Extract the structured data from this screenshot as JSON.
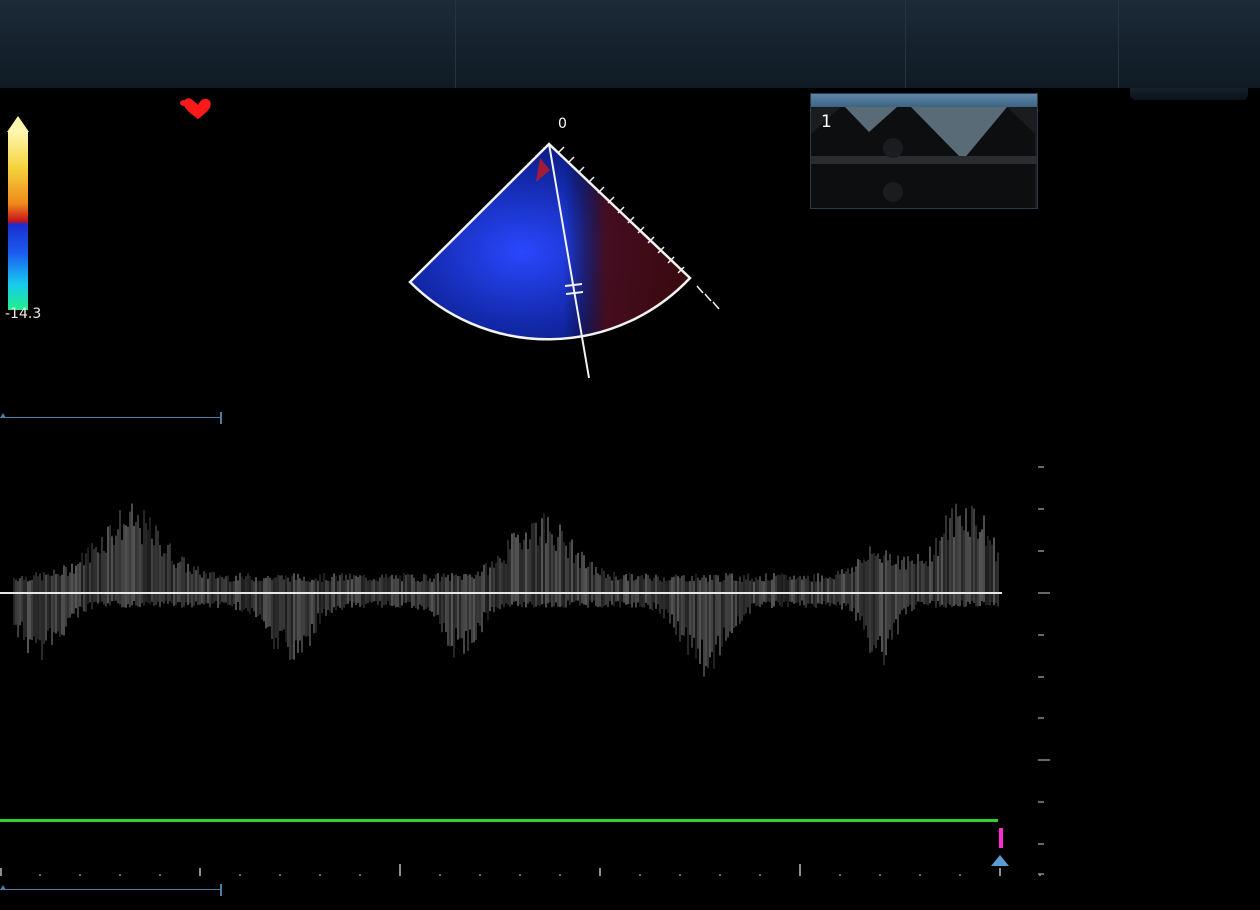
{
  "colors": {
    "ecg_trace": "#2ed12e",
    "marker": "#ff2ad0",
    "heart": "#ff1a1a",
    "baseline": "#e6e6e6",
    "segment_bar": "#4c7ea6"
  },
  "icons": {
    "heart": "heart-icon",
    "marker": "triangle-up-icon"
  },
  "color_scale": {
    "min_label": "-14.3"
  },
  "sector": {
    "angle_label": "0"
  },
  "thumbnail": {
    "index_label": "1"
  }
}
